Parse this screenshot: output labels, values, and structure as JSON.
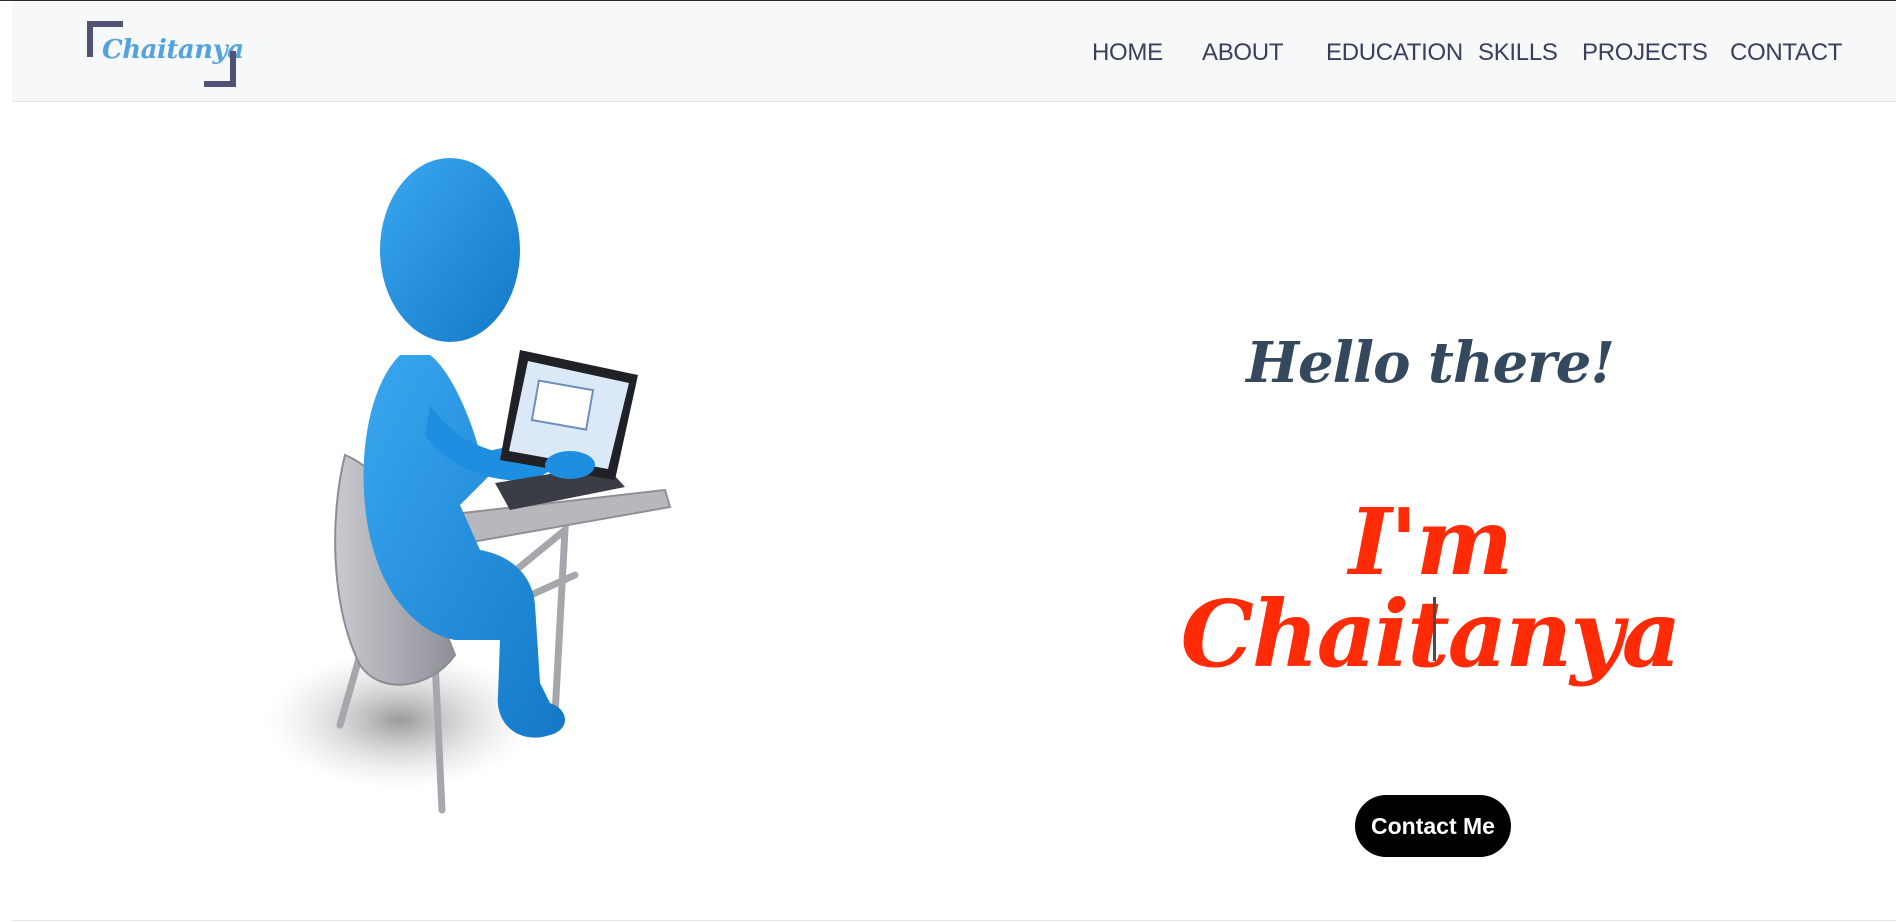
{
  "brand": {
    "name": "Chaitanya"
  },
  "nav": {
    "items": [
      {
        "label": "HOME"
      },
      {
        "label": "ABOUT"
      },
      {
        "label": "EDUCATION"
      },
      {
        "label": "SKILLS"
      },
      {
        "label": "PROJECTS"
      },
      {
        "label": "CONTACT"
      }
    ]
  },
  "hero": {
    "greeting": "Hello there!",
    "name_line": "I'm Chaitanya",
    "contact_button": "Contact Me",
    "illustration": "person-at-laptop-illustration"
  },
  "colors": {
    "brand": "#54a3dc",
    "accent": "#ff2a06",
    "heading": "#34495e",
    "nav_text": "#3a3f5c",
    "button_bg": "#000000"
  }
}
